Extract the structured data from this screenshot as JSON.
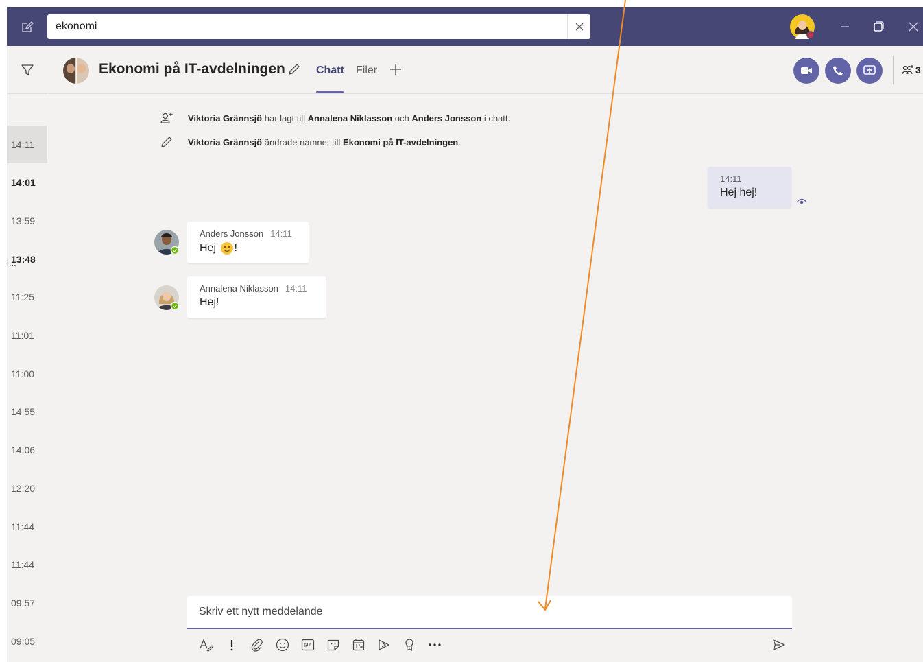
{
  "titlebar": {
    "search_value": "ekonomi",
    "search_placeholder": ""
  },
  "timestamps": [
    {
      "time": "14:11",
      "bold": false,
      "selected": true
    },
    {
      "time": "14:01",
      "bold": true,
      "selected": false
    },
    {
      "time": "13:59",
      "bold": false,
      "selected": false
    },
    {
      "time": "13:48",
      "bold": true,
      "selected": false
    },
    {
      "time": "11:25",
      "bold": false,
      "selected": false
    },
    {
      "time": "11:01",
      "bold": false,
      "selected": false
    },
    {
      "time": "11:00",
      "bold": false,
      "selected": false
    },
    {
      "time": "14:55",
      "bold": false,
      "selected": false
    },
    {
      "time": "14:06",
      "bold": false,
      "selected": false
    },
    {
      "time": "12:20",
      "bold": false,
      "selected": false
    },
    {
      "time": "11:44",
      "bold": false,
      "selected": false
    },
    {
      "time": "11:44",
      "bold": false,
      "selected": false
    },
    {
      "time": "09:57",
      "bold": false,
      "selected": false
    },
    {
      "time": "09:05",
      "bold": false,
      "selected": false
    }
  ],
  "truncated_marker": "l...",
  "header": {
    "title": "Ekonomi på IT-avdelningen",
    "tabs": [
      {
        "label": "Chatt",
        "active": true
      },
      {
        "label": "Filer",
        "active": false
      }
    ],
    "participants_count": "3"
  },
  "system_messages": [
    {
      "icon": "add-person-icon",
      "actor": "Viktoria Grännsjö",
      "text1": " har lagt till ",
      "target1": "Annalena Niklasson",
      "text2": " och ",
      "target2": "Anders Jonsson",
      "text3": " i chatt."
    },
    {
      "icon": "pencil-icon",
      "actor": "Viktoria Grännsjö",
      "text1": " ändrade namnet till ",
      "target1": "Ekonomi på IT-avdelningen",
      "text2": ".",
      "target2": "",
      "text3": ""
    }
  ],
  "messages": [
    {
      "author": "",
      "time": "14:11",
      "text": "Hej hej!",
      "mine": true
    },
    {
      "author": "Anders Jonsson",
      "time": "14:11",
      "text": "Hej ",
      "suffix": "!",
      "emoji": "smile-emoji",
      "mine": false
    },
    {
      "author": "Annalena Niklasson",
      "time": "14:11",
      "text": "Hej!",
      "mine": false
    }
  ],
  "compose": {
    "placeholder": "Skriv ett nytt meddelande"
  },
  "colors": {
    "titlebar": "#464775",
    "accent": "#6264a7",
    "background": "#f3f2f1",
    "presence_available": "#6bb700",
    "presence_busy": "#c4314b",
    "annotation_arrow": "#f08a24"
  }
}
